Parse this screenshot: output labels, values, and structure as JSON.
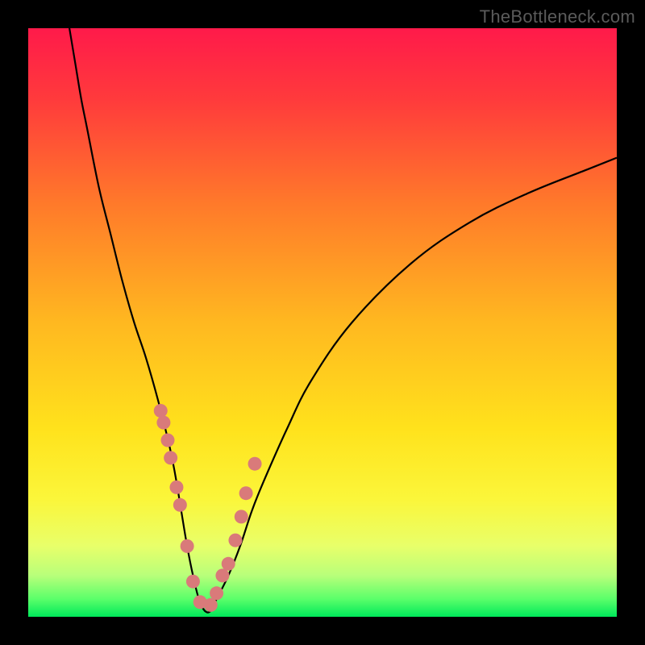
{
  "watermark": "TheBottleneck.com",
  "chart_data": {
    "type": "line",
    "title": "",
    "xlabel": "",
    "ylabel": "",
    "xlim": [
      0,
      100
    ],
    "ylim": [
      0,
      100
    ],
    "series": [
      {
        "name": "bottleneck-curve",
        "x": [
          7,
          8,
          9,
          10,
          12,
          14,
          16,
          18,
          20,
          22,
          24,
          25,
          26,
          27,
          28,
          29,
          30,
          31,
          32,
          34,
          36,
          38,
          40,
          44,
          48,
          55,
          65,
          75,
          85,
          95,
          100
        ],
        "y": [
          100,
          94,
          88,
          83,
          73,
          65,
          57,
          50,
          44,
          37,
          29,
          24,
          18,
          12,
          7,
          3,
          1,
          1,
          3,
          7,
          12,
          18,
          23,
          32,
          40,
          50,
          60,
          67,
          72,
          76,
          78
        ]
      }
    ],
    "markers": {
      "name": "data-points",
      "x": [
        22.5,
        23,
        23.7,
        24.2,
        25.2,
        25.8,
        27.0,
        28.0,
        29.2,
        31.0,
        32.0,
        33.0,
        34.0,
        35.2,
        36.2,
        37.0,
        38.5
      ],
      "y": [
        35,
        33,
        30,
        27,
        22,
        19,
        12,
        6,
        2.5,
        2,
        4,
        7,
        9,
        13,
        17,
        21,
        26
      ]
    },
    "gradient_stops": [
      {
        "offset": 0.0,
        "color": "#ff1a4a"
      },
      {
        "offset": 0.12,
        "color": "#ff3a3c"
      },
      {
        "offset": 0.3,
        "color": "#ff7a2a"
      },
      {
        "offset": 0.5,
        "color": "#ffb820"
      },
      {
        "offset": 0.68,
        "color": "#ffe21c"
      },
      {
        "offset": 0.8,
        "color": "#fbf63a"
      },
      {
        "offset": 0.88,
        "color": "#e8ff6a"
      },
      {
        "offset": 0.93,
        "color": "#b8ff7a"
      },
      {
        "offset": 0.97,
        "color": "#5aff6a"
      },
      {
        "offset": 1.0,
        "color": "#00e85a"
      }
    ],
    "marker_color": "#d97a7a",
    "curve_color": "#000000"
  }
}
